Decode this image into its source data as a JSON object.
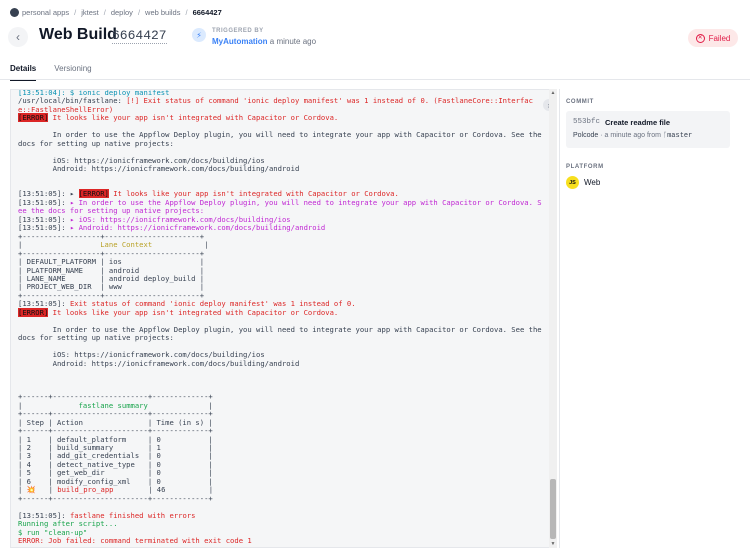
{
  "breadcrumb": {
    "items": [
      "personal apps",
      "jktest",
      "deploy",
      "web builds"
    ],
    "current": "6664427"
  },
  "header": {
    "title": "Web Build",
    "build_id": "6664427",
    "trigger_label": "TRIGGERED BY",
    "trigger_user": "MyAutomation",
    "trigger_time": "a minute ago",
    "status": "Failed"
  },
  "tabs": [
    {
      "label": "Details",
      "active": true
    },
    {
      "label": "Versioning",
      "active": false
    }
  ],
  "log": {
    "lines": [
      [
        {
          "t": "[13:51:04]: $ ionic deploy manifest",
          "c": "c"
        }
      ],
      [
        {
          "t": "/usr/local/bin/fastlane: "
        },
        {
          "t": "[!] Exit status of command 'ionic deploy manifest' was 1 instead of 0. (FastlaneCore::Interfac",
          "c": "r"
        }
      ],
      [
        {
          "t": "e::FastlaneShellError)",
          "c": "r"
        }
      ],
      [
        {
          "t": "[ERROR]",
          "c": "tag"
        },
        {
          "t": " It looks like your app isn't integrated with Capacitor or Cordova.",
          "c": "r"
        }
      ],
      [
        {
          "t": ""
        }
      ],
      [
        {
          "t": "        In order to use the Appflow Deploy plugin, you will need to integrate your app with Capacitor or Cordova. See the"
        }
      ],
      [
        {
          "t": "docs for setting up native projects:"
        }
      ],
      [
        {
          "t": ""
        }
      ],
      [
        {
          "t": "        iOS: https://ionicframework.com/docs/building/ios"
        }
      ],
      [
        {
          "t": "        Android: https://ionicframework.com/docs/building/android"
        }
      ],
      [
        {
          "t": ""
        }
      ],
      [
        {
          "t": ""
        }
      ],
      [
        {
          "t": "[13:51:05]: ▸ "
        },
        {
          "t": "[ERROR]",
          "c": "tag"
        },
        {
          "t": " It looks like your app isn't integrated with Capacitor or Cordova.",
          "c": "r"
        }
      ],
      [
        {
          "t": "[13:51:05]: "
        },
        {
          "t": "▸ In order to use the Appflow Deploy plugin, you will need to integrate your app with Capacitor or Cordova. S",
          "c": "m"
        }
      ],
      [
        {
          "t": "ee the docs for setting up native projects:",
          "c": "m"
        }
      ],
      [
        {
          "t": "[13:51:05]: "
        },
        {
          "t": "▸ iOS: https://ionicframework.com/docs/building/ios",
          "c": "m"
        }
      ],
      [
        {
          "t": "[13:51:05]: "
        },
        {
          "t": "▸ Android: https://ionicframework.com/docs/building/android",
          "c": "m"
        }
      ],
      [
        {
          "t": "+------------------+----------------------+"
        }
      ],
      [
        {
          "t": "|                  "
        },
        {
          "t": "Lane Context",
          "c": "y"
        },
        {
          "t": "            |"
        }
      ],
      [
        {
          "t": "+------------------+----------------------+"
        }
      ],
      [
        {
          "t": "| DEFAULT_PLATFORM | ios                  |"
        }
      ],
      [
        {
          "t": "| PLATFORM_NAME    | android              |"
        }
      ],
      [
        {
          "t": "| LANE_NAME        | android deploy_build |"
        }
      ],
      [
        {
          "t": "| PROJECT_WEB_DIR  | www                  |"
        }
      ],
      [
        {
          "t": "+------------------+----------------------+"
        }
      ],
      [
        {
          "t": "[13:51:05]: "
        },
        {
          "t": "Exit status of command 'ionic deploy manifest' was 1 instead of 0.",
          "c": "r"
        }
      ],
      [
        {
          "t": "[ERROR]",
          "c": "tag"
        },
        {
          "t": " It looks like your app isn't integrated with Capacitor or Cordova.",
          "c": "r"
        }
      ],
      [
        {
          "t": ""
        }
      ],
      [
        {
          "t": "        In order to use the Appflow Deploy plugin, you will need to integrate your app with Capacitor or Cordova. See the"
        }
      ],
      [
        {
          "t": "docs for setting up native projects:"
        }
      ],
      [
        {
          "t": ""
        }
      ],
      [
        {
          "t": "        iOS: https://ionicframework.com/docs/building/ios"
        }
      ],
      [
        {
          "t": "        Android: https://ionicframework.com/docs/building/android"
        }
      ],
      [
        {
          "t": ""
        }
      ],
      [
        {
          "t": ""
        }
      ],
      [
        {
          "t": ""
        }
      ],
      [
        {
          "t": "+------+----------------------+-------------+"
        }
      ],
      [
        {
          "t": "|             "
        },
        {
          "t": "fastlane summary",
          "c": "g"
        },
        {
          "t": "              |"
        }
      ],
      [
        {
          "t": "+------+----------------------+-------------+"
        }
      ],
      [
        {
          "t": "| Step | Action               | Time (in s) |"
        }
      ],
      [
        {
          "t": "+------+----------------------+-------------+"
        }
      ],
      [
        {
          "t": "| 1    | default_platform     | 0           |"
        }
      ],
      [
        {
          "t": "| 2    | build_summary        | 1           |"
        }
      ],
      [
        {
          "t": "| 3    | add_git_credentials  | 0           |"
        }
      ],
      [
        {
          "t": "| 4    | detect_native_type   | 0           |"
        }
      ],
      [
        {
          "t": "| 5    | get_web_dir          | 0           |"
        }
      ],
      [
        {
          "t": "| 6    | modify_config_xml    | 0           |"
        }
      ],
      [
        {
          "t": "| "
        },
        {
          "t": "💥",
          "c": "r"
        },
        {
          "t": "   | "
        },
        {
          "t": "build_pro_app",
          "c": "r"
        },
        {
          "t": "        | 46          |"
        }
      ],
      [
        {
          "t": "+------+----------------------+-------------+"
        }
      ],
      [
        {
          "t": ""
        }
      ],
      [
        {
          "t": "[13:51:05]: "
        },
        {
          "t": "fastlane finished with errors",
          "c": "r"
        }
      ],
      [
        {
          "t": "Running after script...",
          "c": "g"
        }
      ],
      [
        {
          "t": "$ run \"clean-up\"",
          "c": "g"
        }
      ],
      [
        {
          "t": "ERROR: Job failed: command terminated with exit code 1",
          "c": "r"
        }
      ]
    ]
  },
  "commit": {
    "heading": "COMMIT",
    "hash": "553bfc",
    "message": "Create readme file",
    "author": "Polcode",
    "time": "a minute ago from",
    "branch": "master"
  },
  "platform": {
    "heading": "PLATFORM",
    "icon_text": "JS",
    "name": "Web"
  },
  "colors": {
    "failed": "#e11d48",
    "link": "#3b82f6",
    "error_text": "#dc2626",
    "magenta": "#c026d3"
  }
}
